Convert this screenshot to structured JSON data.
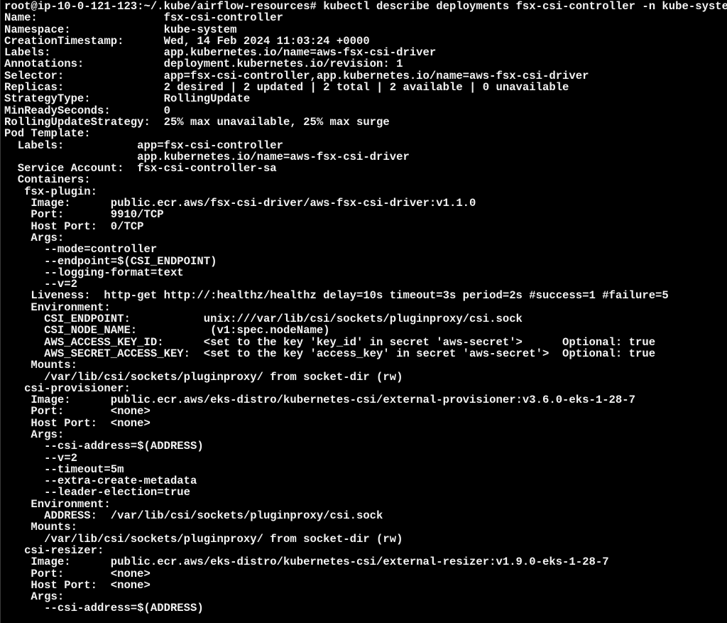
{
  "terminal": {
    "prompt": "root@ip-10-0-121-123:~/.kube/airflow-resources# ",
    "command": "kubectl describe deployments fsx-csi-controller -n kube-system",
    "fg_color": "#f2f2f2",
    "bg_color": "#000000",
    "output": [
      "Name:                   fsx-csi-controller",
      "Namespace:              kube-system",
      "CreationTimestamp:      Wed, 14 Feb 2024 11:03:24 +0000",
      "Labels:                 app.kubernetes.io/name=aws-fsx-csi-driver",
      "Annotations:            deployment.kubernetes.io/revision: 1",
      "Selector:               app=fsx-csi-controller,app.kubernetes.io/name=aws-fsx-csi-driver",
      "Replicas:               2 desired | 2 updated | 2 total | 2 available | 0 unavailable",
      "StrategyType:           RollingUpdate",
      "MinReadySeconds:        0",
      "RollingUpdateStrategy:  25% max unavailable, 25% max surge",
      "Pod Template:",
      "  Labels:           app=fsx-csi-controller",
      "                    app.kubernetes.io/name=aws-fsx-csi-driver",
      "  Service Account:  fsx-csi-controller-sa",
      "  Containers:",
      "   fsx-plugin:",
      "    Image:      public.ecr.aws/fsx-csi-driver/aws-fsx-csi-driver:v1.1.0",
      "    Port:       9910/TCP",
      "    Host Port:  0/TCP",
      "    Args:",
      "      --mode=controller",
      "      --endpoint=$(CSI_ENDPOINT)",
      "      --logging-format=text",
      "      --v=2",
      "    Liveness:  http-get http://:healthz/healthz delay=10s timeout=3s period=2s #success=1 #failure=5",
      "    Environment:",
      "      CSI_ENDPOINT:           unix:///var/lib/csi/sockets/pluginproxy/csi.sock",
      "      CSI_NODE_NAME:           (v1:spec.nodeName)",
      "      AWS_ACCESS_KEY_ID:      <set to the key 'key_id' in secret 'aws-secret'>      Optional: true",
      "      AWS_SECRET_ACCESS_KEY:  <set to the key 'access_key' in secret 'aws-secret'>  Optional: true",
      "    Mounts:",
      "      /var/lib/csi/sockets/pluginproxy/ from socket-dir (rw)",
      "   csi-provisioner:",
      "    Image:      public.ecr.aws/eks-distro/kubernetes-csi/external-provisioner:v3.6.0-eks-1-28-7",
      "    Port:       <none>",
      "    Host Port:  <none>",
      "    Args:",
      "      --csi-address=$(ADDRESS)",
      "      --v=2",
      "      --timeout=5m",
      "      --extra-create-metadata",
      "      --leader-election=true",
      "    Environment:",
      "      ADDRESS:  /var/lib/csi/sockets/pluginproxy/csi.sock",
      "    Mounts:",
      "      /var/lib/csi/sockets/pluginproxy/ from socket-dir (rw)",
      "   csi-resizer:",
      "    Image:      public.ecr.aws/eks-distro/kubernetes-csi/external-resizer:v1.9.0-eks-1-28-7",
      "    Port:       <none>",
      "    Host Port:  <none>",
      "    Args:",
      "      --csi-address=$(ADDRESS)"
    ]
  }
}
